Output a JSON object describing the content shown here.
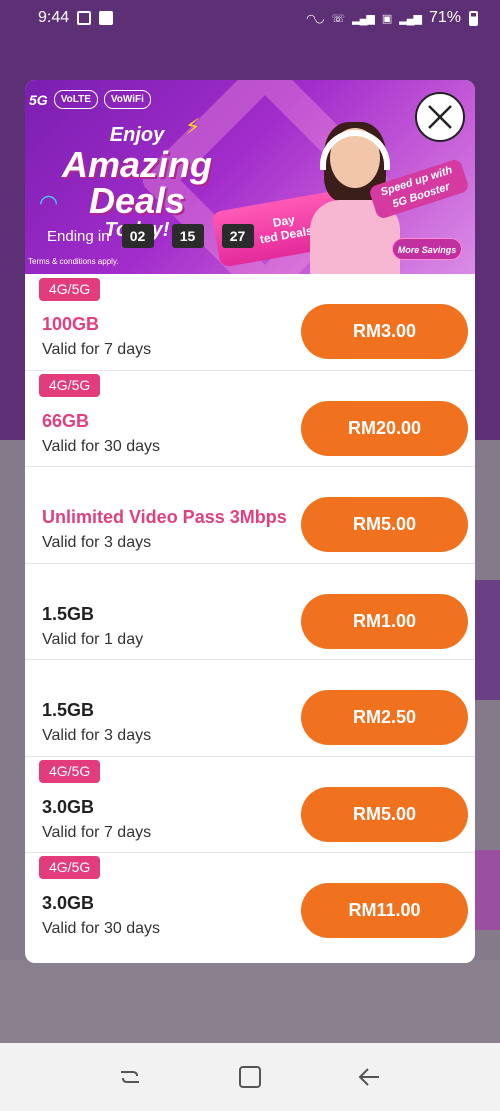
{
  "status_bar": {
    "time": "9:44",
    "battery": "71%"
  },
  "banner": {
    "logos": [
      "5G",
      "VoLTE",
      "VoWiFi"
    ],
    "headline_1": "Enjoy",
    "headline_2": "Amazing",
    "headline_3": "Deals",
    "headline_4": "Today!",
    "ending_label": "Ending in",
    "countdown": [
      "02",
      "15",
      "27"
    ],
    "terms": "Terms & conditions apply.",
    "deals_pill": "Day\nted Deals",
    "booster": "Speed up with\n5G Booster",
    "savings": "More Savings"
  },
  "plans": [
    {
      "tag": "4G/5G",
      "name": "100GB",
      "validity": "Valid for 7 days",
      "price": "RM3.00",
      "pink": true
    },
    {
      "tag": "4G/5G",
      "name": "66GB",
      "validity": "Valid for 30 days",
      "price": "RM20.00",
      "pink": true
    },
    {
      "tag": "",
      "name": "Unlimited Video Pass 3Mbps",
      "validity": "Valid for 3 days",
      "price": "RM5.00",
      "pink": true
    },
    {
      "tag": "",
      "name": "1.5GB",
      "validity": "Valid for 1 day",
      "price": "RM1.00",
      "pink": false
    },
    {
      "tag": "",
      "name": "1.5GB",
      "validity": "Valid for 3 days",
      "price": "RM2.50",
      "pink": false
    },
    {
      "tag": "4G/5G",
      "name": "3.0GB",
      "validity": "Valid for 7 days",
      "price": "RM5.00",
      "pink": false
    },
    {
      "tag": "4G/5G",
      "name": "3.0GB",
      "validity": "Valid for 30 days",
      "price": "RM11.00",
      "pink": false
    }
  ],
  "colors": {
    "accent_orange": "#f0721f",
    "tag_pink": "#e23c7c",
    "name_pink": "#e0407f"
  }
}
